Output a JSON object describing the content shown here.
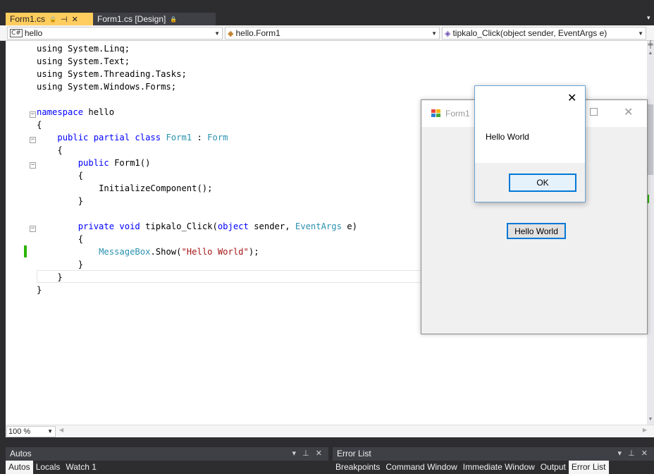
{
  "tabs": {
    "active_label": "Form1.cs",
    "pin_glyph": "⊣",
    "close_glyph": "✕",
    "lock_glyph": "🔒",
    "design_label": "Form1.cs [Design]"
  },
  "navbar": {
    "project": "hello",
    "project_badge": "C#",
    "class": "hello.Form1",
    "member": "tipkalo_Click(object sender, EventArgs e)"
  },
  "code": {
    "using1": "using System.Linq;",
    "using2": "using System.Text;",
    "using3": "using System.Threading.Tasks;",
    "using4": "using System.Windows.Forms;",
    "namespace_kw": "namespace",
    "namespace_name": " hello",
    "open_ns": "{",
    "class_mods": "public partial class",
    "class_name": " Form1",
    "class_colon": " : ",
    "class_base": "Form",
    "open_class": "{",
    "ctor_kw": "public",
    "ctor_name": " Form1()",
    "open_ctor": "{",
    "init_call": "InitializeComponent();",
    "close_ctor": "}",
    "method_kw": "private void",
    "method_name": " tipkalo_Click(",
    "param1_kw": "object",
    "param1_name": " sender, ",
    "param2_type": "EventArgs",
    "param2_name": " e)",
    "open_method": "{",
    "mb_type": "MessageBox",
    "mb_call": ".Show(",
    "mb_string": "\"Hello World\"",
    "mb_end": ");",
    "close_method": "}",
    "close_class": "}",
    "close_ns": "}"
  },
  "zoom": "100 %",
  "form1": {
    "title": "Form1",
    "button_label": "Hello World"
  },
  "messagebox": {
    "text": "Hello World",
    "ok_label": "OK",
    "close_glyph": "✕"
  },
  "panels": {
    "autos_title": "Autos",
    "errors_title": "Error List",
    "left_tabs": [
      "Autos",
      "Locals",
      "Watch 1"
    ],
    "right_tabs": [
      "Breakpoints",
      "Command Window",
      "Immediate Window",
      "Output",
      "Error List"
    ]
  },
  "colors": {
    "active_tab": "#ffcc5e",
    "ide_dark": "#2d2d30",
    "keyword": "#0000ff",
    "type": "#2b91af",
    "string": "#a31515",
    "accent_blue": "#0078d7",
    "change_marker": "#2bb400"
  }
}
